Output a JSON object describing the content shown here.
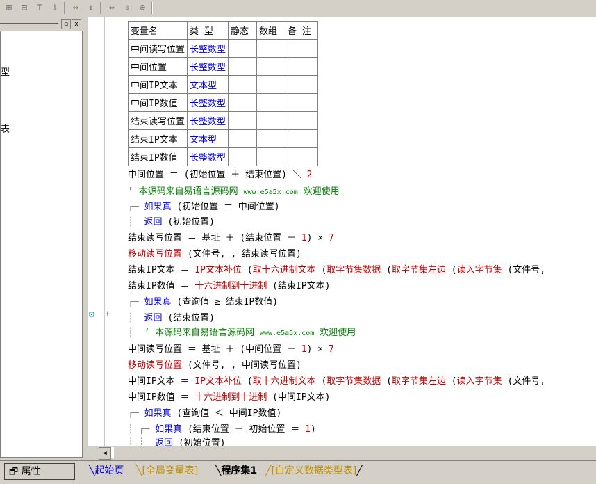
{
  "table": {
    "headers": [
      "变量名",
      "类 型",
      "静态",
      "数组",
      "备 注"
    ],
    "rows": [
      {
        "name": "中间读写位置",
        "type": "长整数型"
      },
      {
        "name": "中间位置",
        "type": "长整数型"
      },
      {
        "name": "中间IP文本",
        "type": "文本型"
      },
      {
        "name": "中间IP数值",
        "type": "长整数型"
      },
      {
        "name": "结束读写位置",
        "type": "长整数型"
      },
      {
        "name": "结束IP文本",
        "type": "文本型"
      },
      {
        "name": "结束IP数值",
        "type": "长整数型"
      }
    ]
  },
  "code": {
    "l1": {
      "a": "中间位置 ＝ (初始位置 ＋ 结束位置) ＼ ",
      "b": "2"
    },
    "l2": {
      "a": "’ 本源码来自易语言源码网 ",
      "b": "www.e5a5x.com",
      "c": " 欢迎使用"
    },
    "l3": {
      "a": "如果真",
      "b": " (初始位置 ＝ 中间位置)"
    },
    "l4": {
      "a": "返回",
      "b": " (初始位置)"
    },
    "l5": {
      "a": "结束读写位置 ＝ 基址 ＋ (结束位置 － ",
      "b": "1",
      "c": ") × ",
      "d": "7"
    },
    "l6": {
      "a": "移动读写位置",
      "b": " (文件号, , 结束读写位置)"
    },
    "l7": {
      "a": "结束IP文本 ＝ ",
      "b": "IP文本补位",
      "c": " (",
      "d": "取十六进制文本",
      "e": " (",
      "f": "取字节集数据",
      "g": " (",
      "h": "取字节集左边",
      "i": " (",
      "j": "读入字节集",
      "k": " (文件号,"
    },
    "l8": {
      "a": "结束IP数值 ＝ ",
      "b": "十六进制到十进制",
      "c": " (结束IP文本)"
    },
    "l9": {
      "a": "如果真",
      "b": " (查询值 ≥ 结束IP数值)"
    },
    "l10": {
      "a": "返回",
      "b": " (结束位置)"
    },
    "l11": {
      "a": "’ 本源码来自易语言源码网 ",
      "b": "www.e5a5x.com",
      "c": " 欢迎使用"
    },
    "l12": {
      "a": "中间读写位置 ＝ 基址 ＋ (中间位置 － ",
      "b": "1",
      "c": ") × ",
      "d": "7"
    },
    "l13": {
      "a": "移动读写位置",
      "b": " (文件号, , 中间读写位置)"
    },
    "l14": {
      "a": "中间IP文本 ＝ ",
      "b": "IP文本补位",
      "c": " (",
      "d": "取十六进制文本",
      "e": " (",
      "f": "取字节集数据",
      "g": " (",
      "h": "取字节集左边",
      "i": " (",
      "j": "读入字节集",
      "k": " (文件号,"
    },
    "l15": {
      "a": "中间IP数值 ＝ ",
      "b": "十六进制到十进制",
      "c": " (中间IP文本)"
    },
    "l16": {
      "a": "如果真",
      "b": " (查询值 ＜ 中间IP数值)"
    },
    "l17": {
      "a": "如果真",
      "b": " (结束位置 － 初始位置 ＝ ",
      "c": "1",
      "d": ")"
    },
    "l18": {
      "a": "返回",
      "b": " (初始位置)"
    }
  },
  "left_panel": {
    "frag1": "型",
    "frag2": "表",
    "min_label": "▫",
    "close_label": "x"
  },
  "bottom": {
    "prop_label": "属性",
    "tabs": [
      "起始页",
      "[全局变量表]",
      "程序集1",
      "[自定义数据类型表]"
    ]
  },
  "colors": {
    "keyword_blue": "#0000e0",
    "command_red": "#c00000",
    "comment_green": "#008000"
  }
}
